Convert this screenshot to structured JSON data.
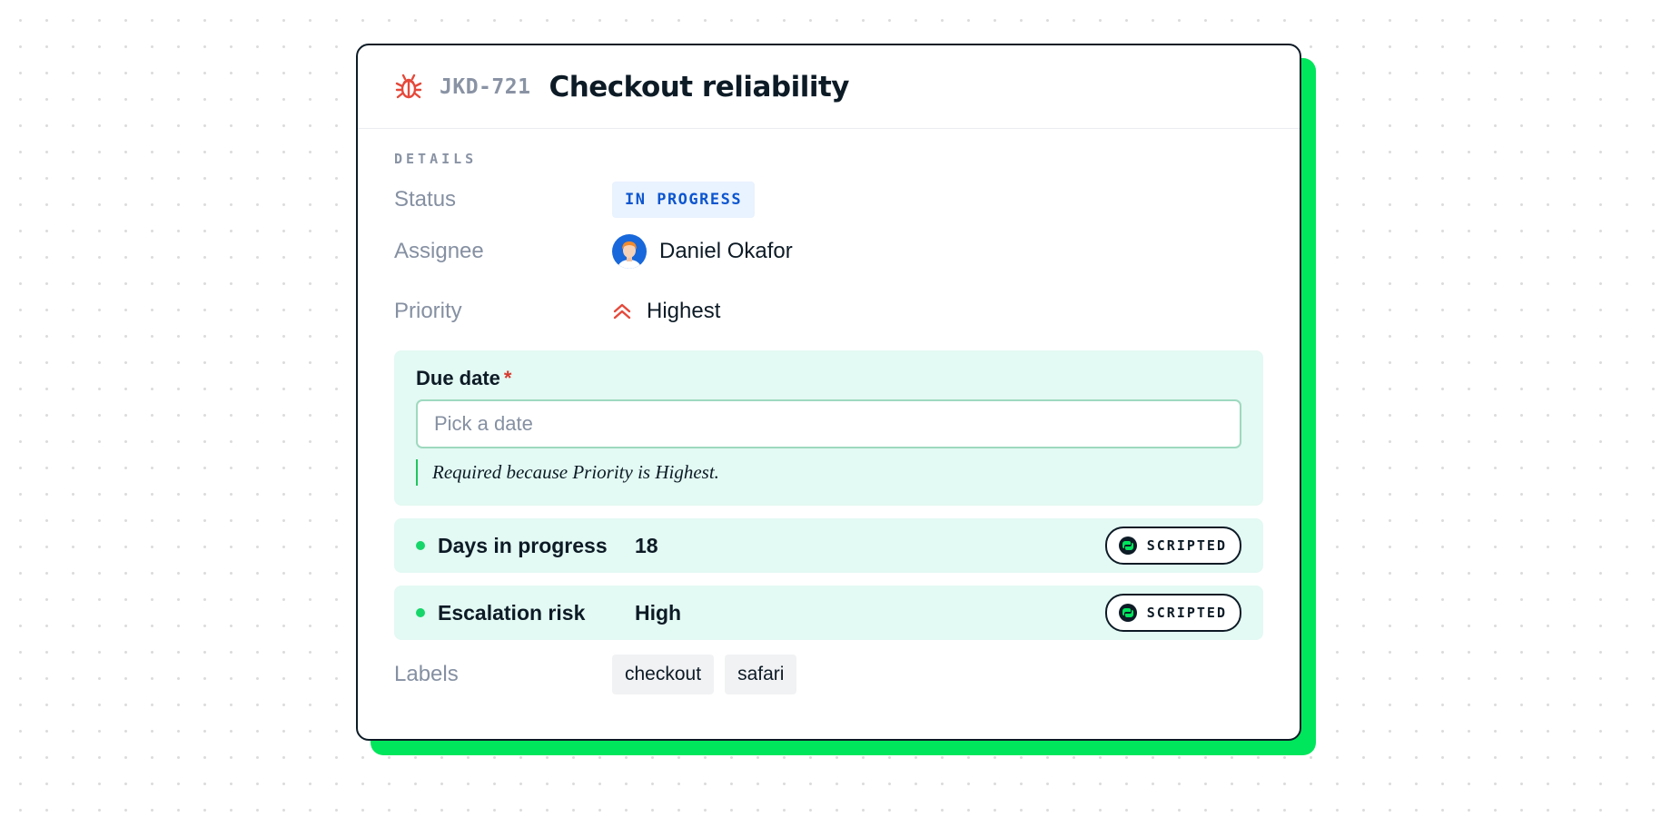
{
  "issue": {
    "type_icon": "bug-icon",
    "key": "JKD-721",
    "title": "Checkout reliability"
  },
  "details": {
    "heading": "DETAILS",
    "status": {
      "label": "Status",
      "value": "IN PROGRESS",
      "color": "#0c55cf",
      "background": "#e9f2ff"
    },
    "assignee": {
      "label": "Assignee",
      "name": "Daniel Okafor",
      "avatar_icon": "avatar"
    },
    "priority": {
      "label": "Priority",
      "value": "Highest",
      "icon": "priority-highest-icon",
      "color": "#e5493a"
    }
  },
  "due_date": {
    "label": "Due date",
    "required_marker": "*",
    "placeholder": "Pick a date",
    "value": "",
    "helper": "Required because Priority is Highest."
  },
  "scripted_fields": [
    {
      "label": "Days in progress",
      "value": "18",
      "badge": "SCRIPTED",
      "badge_icon": "script-icon"
    },
    {
      "label": "Escalation risk",
      "value": "High",
      "badge": "SCRIPTED",
      "badge_icon": "script-icon"
    }
  ],
  "labels": {
    "label": "Labels",
    "items": [
      "checkout",
      "safari"
    ]
  },
  "colors": {
    "accent_shadow": "#00e65c",
    "panel_background": "#e3f9f3",
    "required": "#d63b2f"
  }
}
